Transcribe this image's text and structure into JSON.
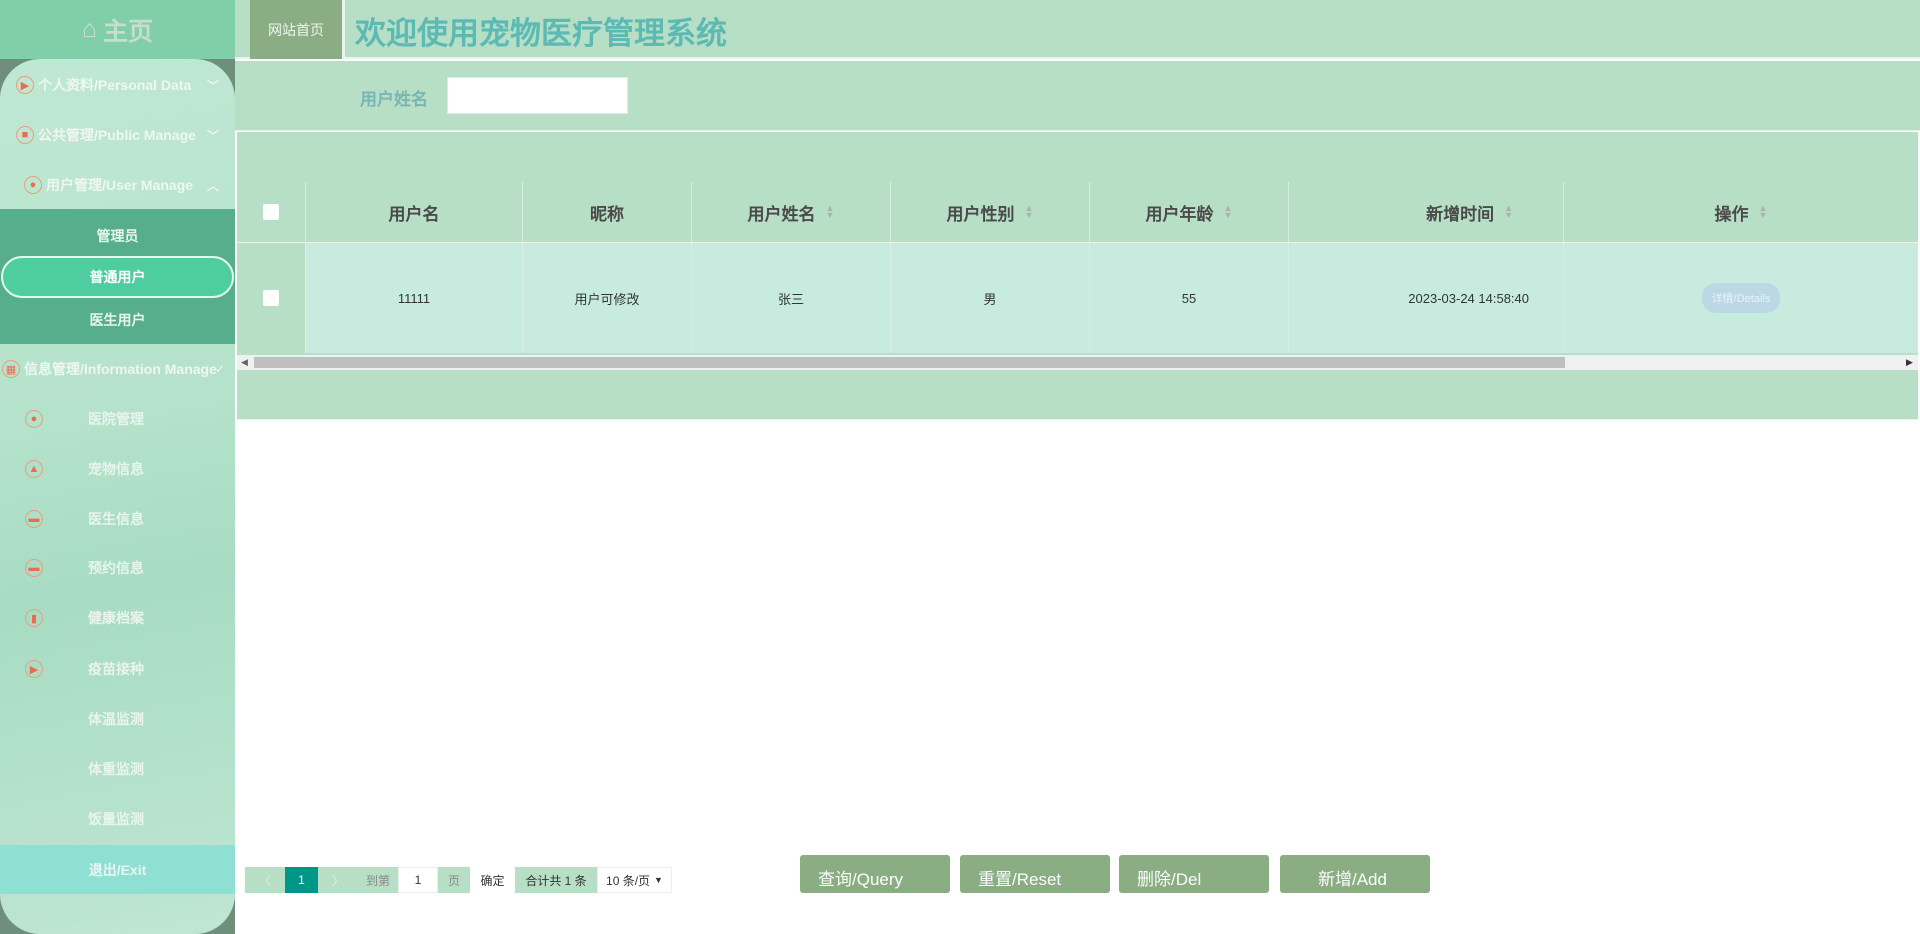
{
  "sidebar": {
    "home": "主页",
    "menus": [
      {
        "label": "个人资料/Personal Data",
        "icon": "flag-icon"
      },
      {
        "label": "公共管理/Public Manage",
        "icon": "gamepad-icon"
      },
      {
        "label": "用户管理/User Manage",
        "icon": "user-icon"
      }
    ],
    "user_sub": [
      "管理员",
      "普通用户",
      "医生用户"
    ],
    "info_menu": "信息管理/Information Manage",
    "info_items": [
      "医院管理",
      "宠物信息",
      "医生信息",
      "预约信息",
      "健康档案",
      "疫苗接种",
      "体温监测",
      "体重监测",
      "饭量监测"
    ],
    "exit": "退出/Exit"
  },
  "header": {
    "home_button": "网站首页",
    "title": "欢迎使用宠物医疗管理系统"
  },
  "search": {
    "label": "用户姓名",
    "value": ""
  },
  "table": {
    "columns": [
      "用户名",
      "昵称",
      "用户姓名",
      "用户性别",
      "用户年龄",
      "新增时间",
      "操作"
    ],
    "rows": [
      {
        "username": "11111",
        "nickname": "用户可修改",
        "name": "张三",
        "gender": "男",
        "age": "55",
        "created": "2023-03-24 14:58:40",
        "action": "详情/Details"
      }
    ]
  },
  "pagination": {
    "current": "1",
    "goto_label": "到第",
    "goto_value": "1",
    "page_unit": "页",
    "confirm": "确定",
    "total": "合计共 1 条",
    "page_size": "10 条/页"
  },
  "buttons": {
    "query": "查询/Query",
    "reset": "重置/Reset",
    "delete": "删除/Del",
    "add": "新增/Add"
  }
}
